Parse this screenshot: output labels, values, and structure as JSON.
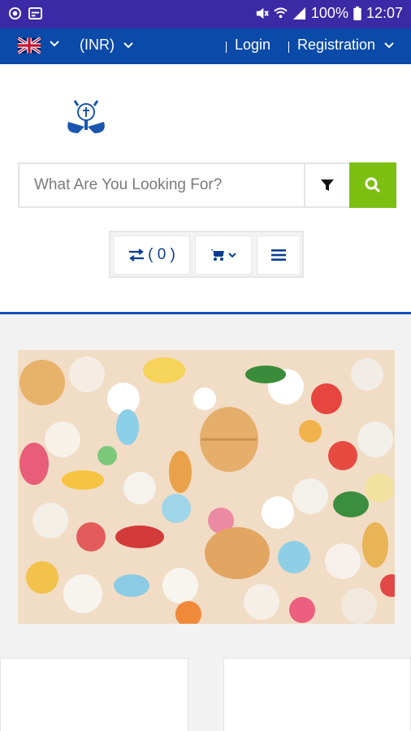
{
  "status_bar": {
    "battery": "100%",
    "time": "12:07"
  },
  "top_nav": {
    "currency": "(INR)",
    "login": "Login",
    "registration": "Registration"
  },
  "search": {
    "placeholder": "What Are You Looking For?"
  },
  "actions": {
    "compare_count": "( 0 )"
  },
  "colors": {
    "status_bar_bg": "#3b2aa6",
    "nav_bg": "#0a4aa8",
    "search_button": "#7cbf11",
    "content_bg": "#f2f2f2"
  },
  "icons": [
    "android-status-icon",
    "calendar-icon",
    "mute-icon",
    "wifi-icon",
    "signal-icon",
    "battery-icon",
    "uk-flag-icon",
    "chevron-down-icon",
    "filter-icon",
    "search-icon",
    "compare-icon",
    "cart-icon",
    "menu-icon"
  ]
}
